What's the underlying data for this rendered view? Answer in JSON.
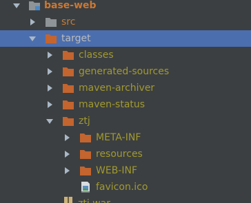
{
  "colors": {
    "background": "#3c3f41",
    "selection": "#4b6eaf",
    "excluded_text": "#a19a2f",
    "module_text": "#cc7832",
    "folder_orange": "#c4642e",
    "folder_grey": "#8e9498"
  },
  "tree": {
    "root": {
      "label": "base-web",
      "icon": "module-folder-icon",
      "expanded": true
    },
    "src": {
      "label": "src",
      "icon": "grey-folder-icon",
      "expanded": false
    },
    "target": {
      "label": "target",
      "icon": "excluded-folder-icon",
      "expanded": true,
      "selected": true
    },
    "classes": {
      "label": "classes",
      "icon": "excluded-folder-icon",
      "expanded": false
    },
    "generated_sources": {
      "label": "generated-sources",
      "icon": "excluded-folder-icon",
      "expanded": false
    },
    "maven_archiver": {
      "label": "maven-archiver",
      "icon": "excluded-folder-icon",
      "expanded": false
    },
    "maven_status": {
      "label": "maven-status",
      "icon": "excluded-folder-icon",
      "expanded": false
    },
    "ztj": {
      "label": "ztj",
      "icon": "excluded-folder-icon",
      "expanded": true
    },
    "meta_inf": {
      "label": "META-INF",
      "icon": "excluded-folder-icon",
      "expanded": false
    },
    "resources": {
      "label": "resources",
      "icon": "excluded-folder-icon",
      "expanded": false
    },
    "web_inf": {
      "label": "WEB-INF",
      "icon": "excluded-folder-icon",
      "expanded": false
    },
    "favicon": {
      "label": "favicon.ico",
      "icon": "image-file-icon"
    },
    "ztj_war": {
      "label": "ztj.war",
      "icon": "archive-file-icon"
    }
  }
}
